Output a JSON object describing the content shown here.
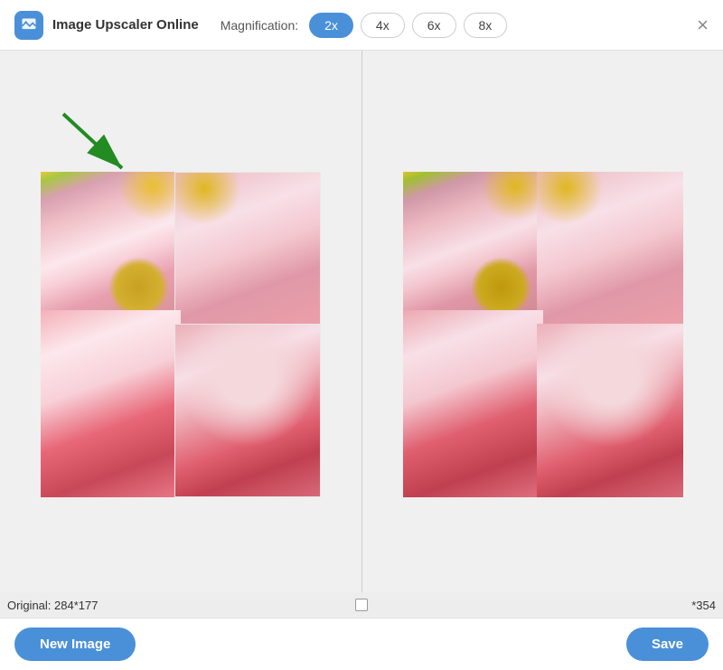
{
  "header": {
    "app_logo_alt": "Image Upscaler Logo",
    "app_title": "Image Upscaler Online",
    "magnification_label": "Magnification:",
    "close_btn_label": "×",
    "mag_buttons": [
      {
        "label": "2x",
        "active": true
      },
      {
        "label": "4x",
        "active": false
      },
      {
        "label": "6x",
        "active": false
      },
      {
        "label": "8x",
        "active": false
      }
    ]
  },
  "main": {
    "left_panel": {
      "info_label": "Original: 284*177",
      "arrow_hint": "green arrow pointing to upscaled region"
    },
    "right_panel": {
      "info_label": "*354"
    },
    "center_checkbox_label": ""
  },
  "footer": {
    "new_image_btn": "New Image",
    "save_btn": "Save"
  }
}
